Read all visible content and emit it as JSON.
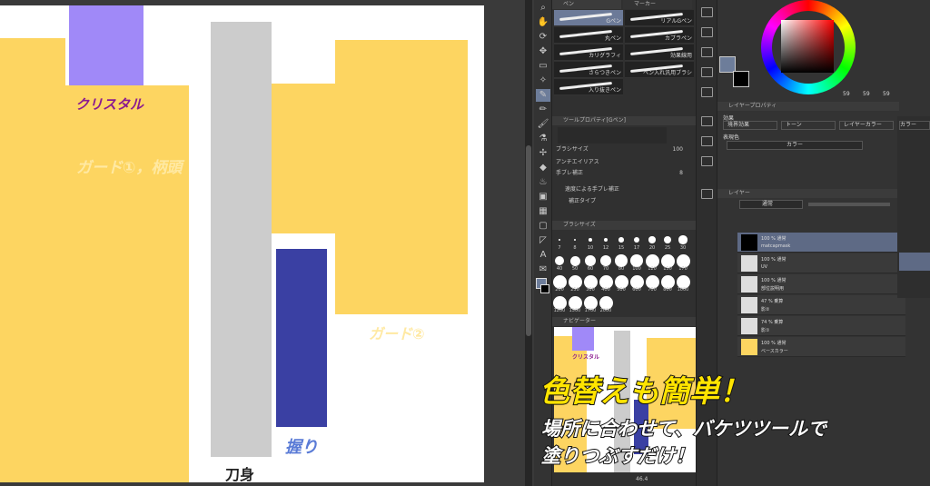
{
  "canvas": {
    "labels": {
      "crystal": "クリスタル",
      "guard1": "ガード①，柄頭",
      "guard2": "ガード②",
      "grip": "握り",
      "blade": "刀身"
    },
    "colors": {
      "yellow": "#fdd561",
      "purple": "#a089f8",
      "gray": "#cccccc",
      "navy": "#3a40a3",
      "crystal_text": "#8a1a8f",
      "guard_text": "#ffe9a3",
      "grip_text": "#5a7bd6"
    }
  },
  "subtool": {
    "tab_pen": "ペン",
    "tab_marker": "マーカー",
    "brushes": [
      {
        "name": "Gペン",
        "selected": true
      },
      {
        "name": "リアルGペン"
      },
      {
        "name": "丸ペン"
      },
      {
        "name": "カブラペン"
      },
      {
        "name": "カリグラフィ"
      },
      {
        "name": "効果線用"
      },
      {
        "name": "さらつきペン"
      },
      {
        "name": "ペン入れ汎用ブラシ"
      },
      {
        "name": "入り抜きペン"
      }
    ]
  },
  "tool_property": {
    "title": "ツールプロパティ[Gペン]",
    "brush_size_label": "ブラシサイズ",
    "brush_size_value": "100",
    "antialias_label": "アンチエイリアス",
    "stabilize_label": "手ブレ補正",
    "stabilize_value": "8",
    "speed_stabilize_label": "速度による手ブレ補正",
    "correction_type_label": "補正タイプ"
  },
  "brush_size_palette": {
    "title": "ブラシサイズ",
    "sizes": [
      "7",
      "8",
      "10",
      "12",
      "15",
      "17",
      "20",
      "25",
      "30",
      "40",
      "50",
      "60",
      "70",
      "80",
      "100",
      "120",
      "150",
      "170",
      "200",
      "250",
      "300",
      "400",
      "500",
      "600",
      "700",
      "800",
      "1000",
      "1200",
      "1500",
      "1700",
      "2000"
    ]
  },
  "navigator": {
    "title": "ナビゲーター",
    "zoom": "46.4",
    "crystal_label": "クリスタル"
  },
  "color": {
    "values": [
      "59",
      "59",
      "59"
    ]
  },
  "layer_property": {
    "title": "レイヤープロパティ",
    "effect_label": "効果",
    "boundary_effect": "境界効果",
    "tone": "トーン",
    "layer_color": "レイヤーカラー",
    "display_color_label": "表現色",
    "display_color_value": "カラー"
  },
  "layers": {
    "title": "レイヤー",
    "blend_mode": "通常",
    "items": [
      {
        "mode": "100 % 通常",
        "name": "matcapmask",
        "selected": true
      },
      {
        "mode": "100 % 通常",
        "name": "UV"
      },
      {
        "mode": "100 % 通常",
        "name": "部位説明用"
      },
      {
        "mode": "47 % 乗算",
        "name": "影②"
      },
      {
        "mode": "74 % 乗算",
        "name": "影①"
      },
      {
        "mode": "100 % 通常",
        "name": "ベースカラー"
      }
    ]
  },
  "far_right": {
    "items": [
      "カラー"
    ]
  },
  "overlay": {
    "headline": "色替えも簡単！",
    "line1": "場所に合わせて、バケツツールで",
    "line2": "塗りつぶすだけ！"
  }
}
